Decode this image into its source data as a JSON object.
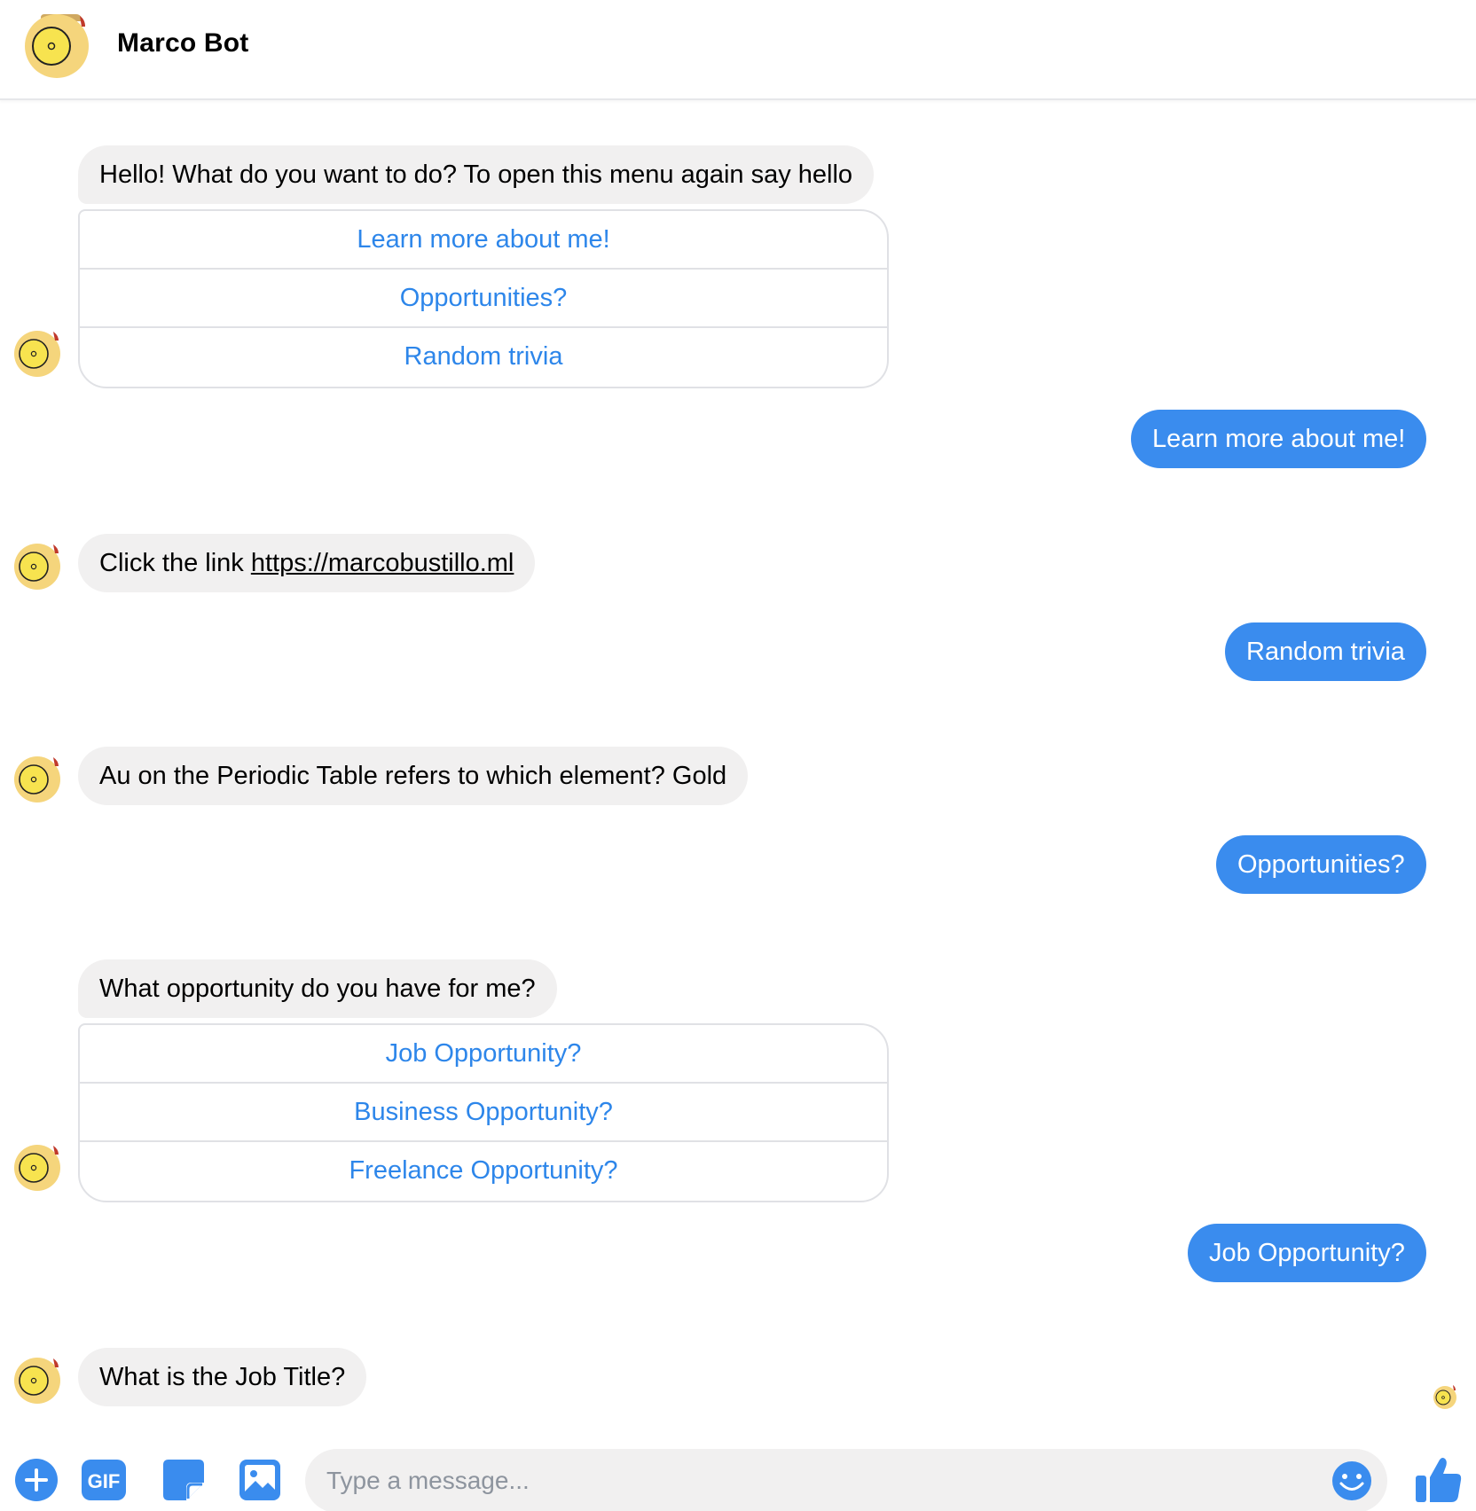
{
  "header": {
    "title": "Marco Bot",
    "avatar_icon": "bot-avatar-icon"
  },
  "colors": {
    "accent": "#3a8cee",
    "link_blue": "#2d86ea",
    "bot_bubble": "#f1f0f0",
    "avatar_yellow": "#f5d57c"
  },
  "messages": {
    "m1": {
      "text": "Hello! What do you want to do? To open this menu again say hello",
      "buttons": [
        "Learn more about me!",
        "Opportunities?",
        "Random trivia"
      ]
    },
    "m2": {
      "text": "Learn more about me!"
    },
    "m3": {
      "prefix": "Click the link ",
      "link": "https://marcobustillo.ml"
    },
    "m4": {
      "text": "Random trivia"
    },
    "m5": {
      "text": "Au on the Periodic Table refers to which element? Gold"
    },
    "m6": {
      "text": "Opportunities?"
    },
    "m7": {
      "text": "What opportunity do you have for me?",
      "buttons": [
        "Job Opportunity?",
        "Business Opportunity?",
        "Freelance Opportunity?"
      ]
    },
    "m8": {
      "text": "Job Opportunity?"
    },
    "m9": {
      "text": "What is the Job Title?"
    }
  },
  "composer": {
    "placeholder": "Type a message...",
    "icons": [
      "plus-icon",
      "gif-icon",
      "sticker-icon",
      "image-icon",
      "emoji-icon",
      "thumbs-up-icon"
    ]
  }
}
